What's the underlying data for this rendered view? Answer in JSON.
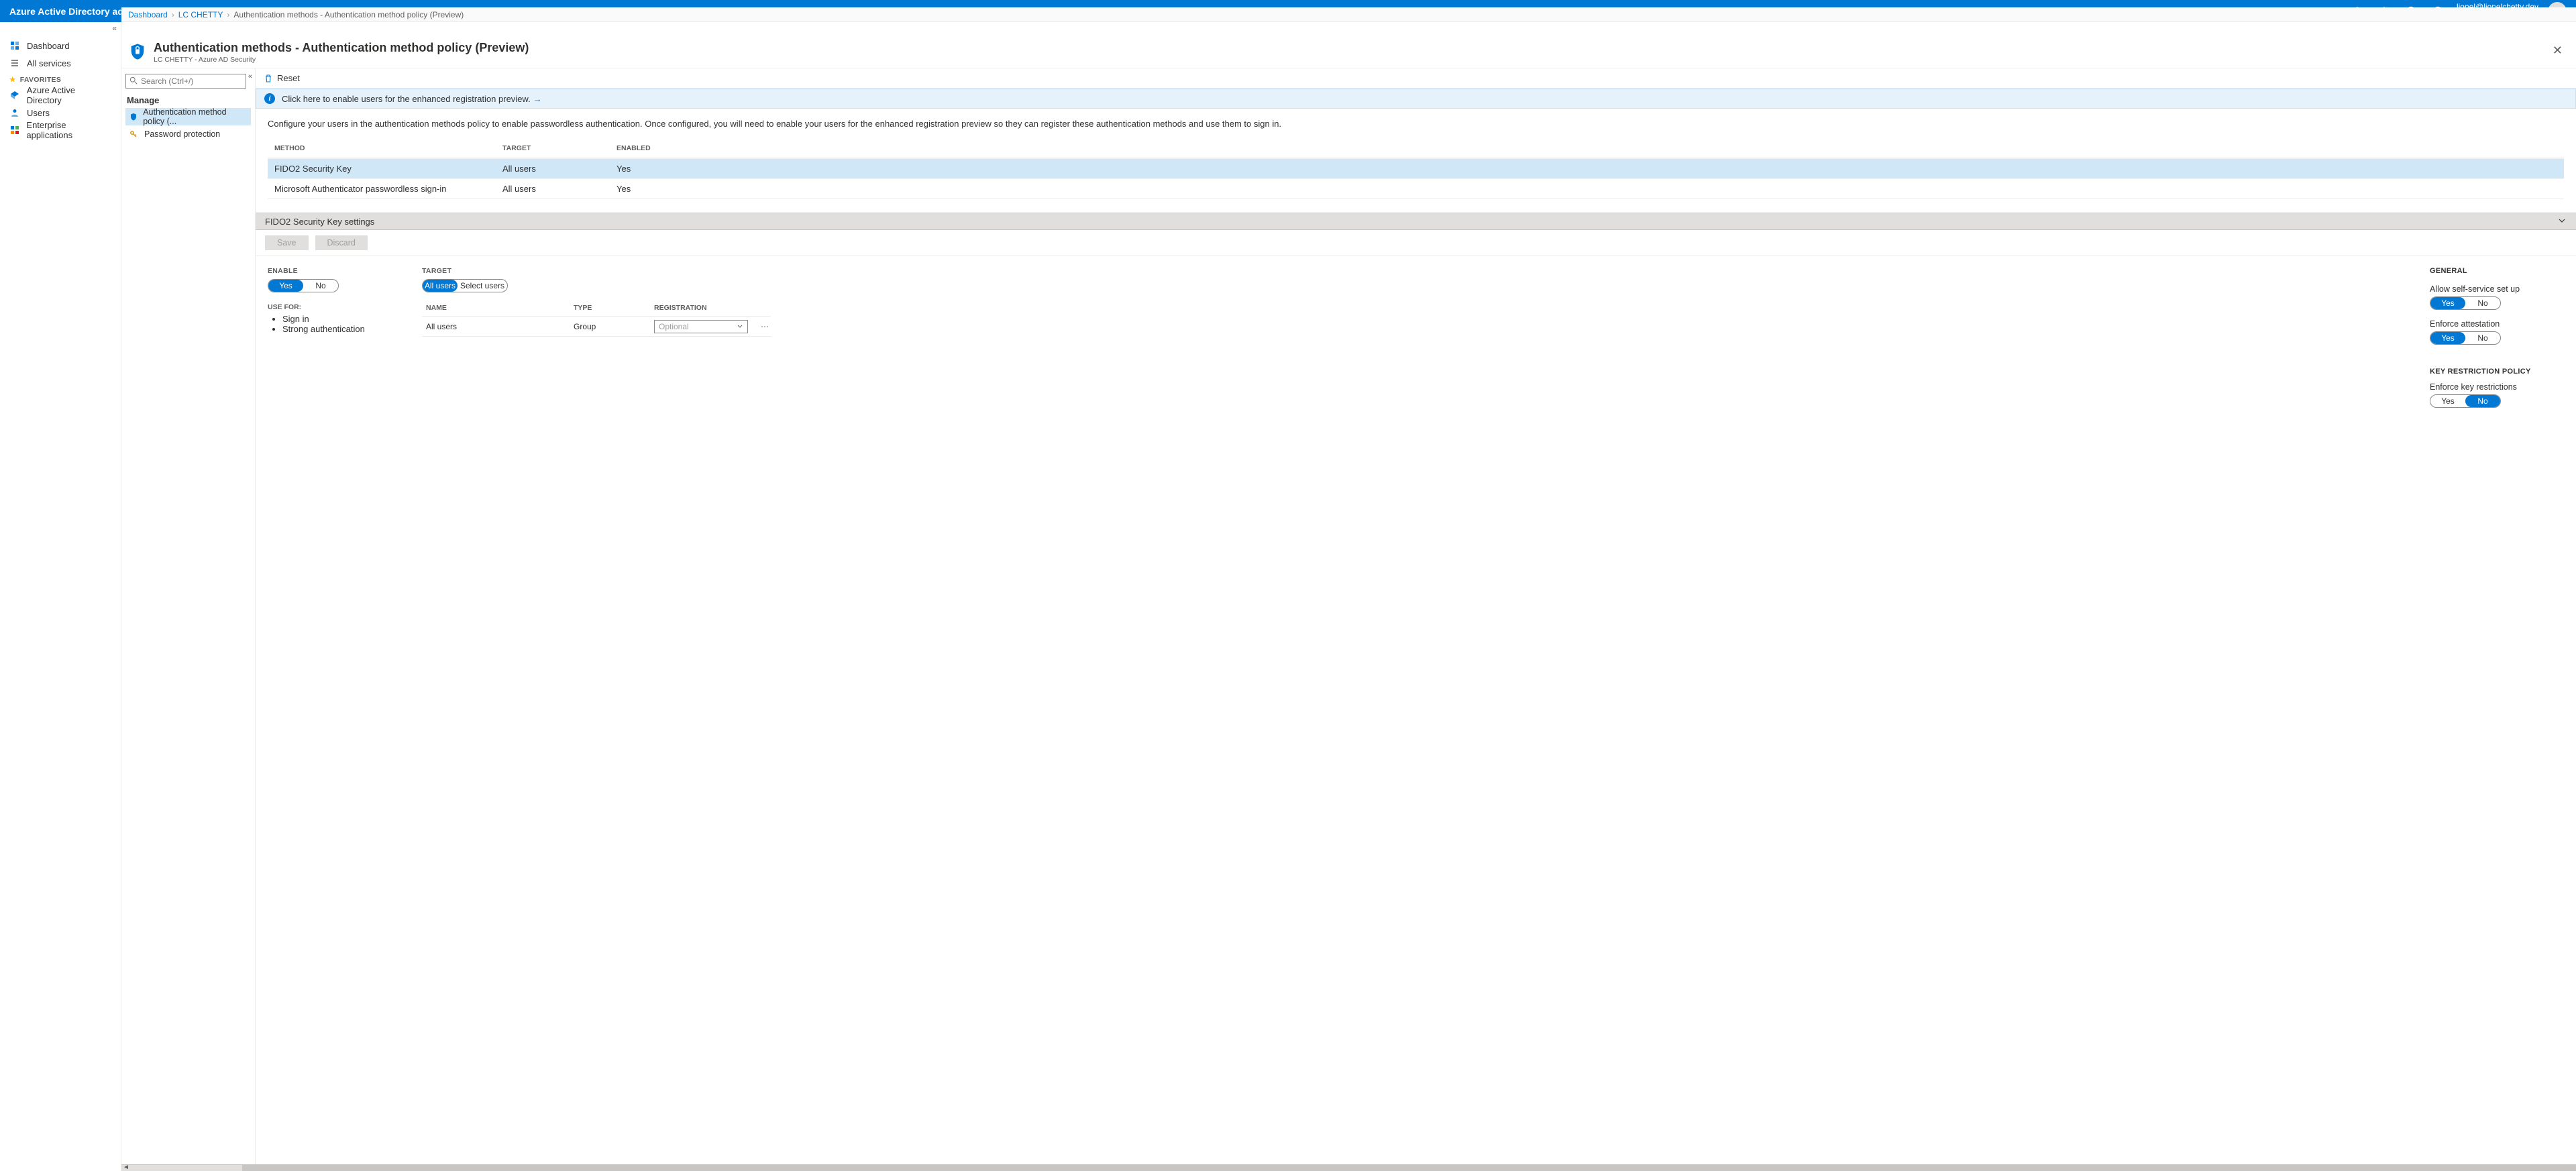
{
  "topbar": {
    "title": "Azure Active Directory admin center",
    "user_email": "lionel@lionelchetty.dev",
    "tenant": "LC CHETTY"
  },
  "breadcrumb": {
    "items": [
      "Dashboard",
      "LC CHETTY",
      "Authentication methods - Authentication method policy (Preview)"
    ]
  },
  "nav": {
    "items": [
      {
        "label": "Dashboard"
      },
      {
        "label": "All services"
      }
    ],
    "favorites_label": "FAVORITES",
    "favorites": [
      {
        "label": "Azure Active Directory"
      },
      {
        "label": "Users"
      },
      {
        "label": "Enterprise applications"
      }
    ]
  },
  "blade": {
    "title": "Authentication methods - Authentication method policy (Preview)",
    "subtitle": "LC CHETTY - Azure AD Security"
  },
  "subnav": {
    "search_placeholder": "Search (Ctrl+/)",
    "section": "Manage",
    "items": [
      {
        "label": "Authentication method policy (...",
        "active": true
      },
      {
        "label": "Password protection",
        "active": false
      }
    ]
  },
  "toolbar": {
    "reset": "Reset"
  },
  "infobar": {
    "text": "Click here to enable users for the enhanced registration preview."
  },
  "description": "Configure your users in the authentication methods policy to enable passwordless authentication. Once configured, you will need to enable your users for the enhanced registration preview so they can register these authentication methods and use them to sign in.",
  "methods": {
    "headers": {
      "method": "METHOD",
      "target": "TARGET",
      "enabled": "ENABLED"
    },
    "rows": [
      {
        "method": "FIDO2 Security Key",
        "target": "All users",
        "enabled": "Yes",
        "selected": true
      },
      {
        "method": "Microsoft Authenticator passwordless sign-in",
        "target": "All users",
        "enabled": "Yes",
        "selected": false
      }
    ]
  },
  "section_title": "FIDO2 Security Key settings",
  "actions": {
    "save": "Save",
    "discard": "Discard"
  },
  "settings": {
    "enable": {
      "label": "ENABLE",
      "yes": "Yes",
      "no": "No"
    },
    "use_for": {
      "label": "USE FOR:",
      "items": [
        "Sign in",
        "Strong authentication"
      ]
    },
    "target": {
      "label": "TARGET",
      "all": "All users",
      "select": "Select users",
      "headers": {
        "name": "NAME",
        "type": "TYPE",
        "registration": "REGISTRATION"
      },
      "row": {
        "name": "All users",
        "type": "Group",
        "registration": "Optional"
      }
    },
    "general": {
      "label": "GENERAL",
      "allow_self": "Allow self-service set up",
      "enforce_attest": "Enforce attestation",
      "yes": "Yes",
      "no": "No",
      "key_policy": "KEY RESTRICTION POLICY",
      "enforce_key": "Enforce key restrictions"
    }
  }
}
